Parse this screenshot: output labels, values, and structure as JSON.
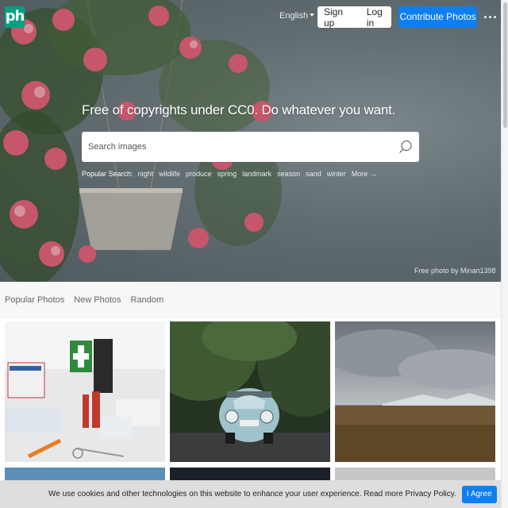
{
  "header": {
    "logo_text": "ph",
    "language": "English",
    "signup": "Sign up",
    "login": "Log in",
    "contribute": "Contribute Photos"
  },
  "hero": {
    "headline": "Free of copyrights under CC0. Do whatever you want.",
    "search_placeholder": "Search images",
    "popular_label": "Popular Search:",
    "popular_tags": [
      "night",
      "wildlife",
      "produce",
      "spring",
      "landmark",
      "season",
      "sand",
      "winter"
    ],
    "more": "More →",
    "credit": "Free photo by Minan1398"
  },
  "tabs": [
    "Popular Photos",
    "New Photos",
    "Random"
  ],
  "cookie": {
    "message": "We use cookies and other technologies on this website to enhance your user experience. Read more Privacy Policy.",
    "agree": "I Agree"
  },
  "colors": {
    "logo": "#05a081",
    "primary": "#0d7ff0"
  }
}
